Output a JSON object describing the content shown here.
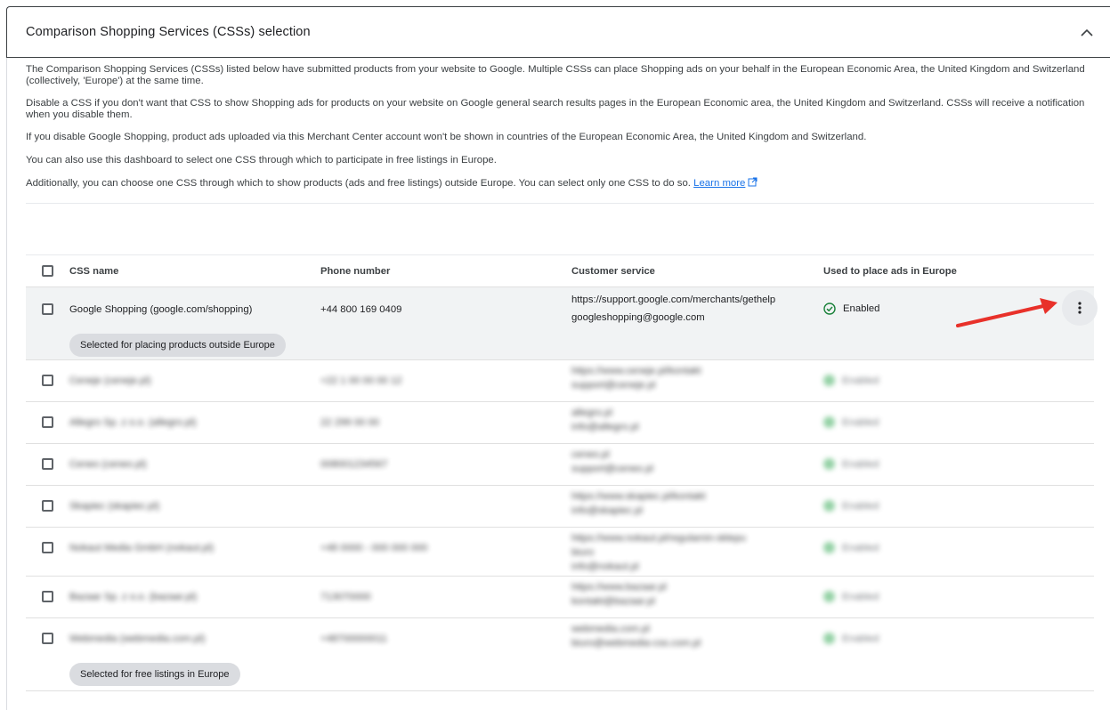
{
  "panel": {
    "title": "Comparison Shopping Services (CSSs) selection",
    "collapse_icon": "chevron-up-icon"
  },
  "intro": {
    "p1": "The Comparison Shopping Services (CSSs) listed below have submitted products from your website to Google. Multiple CSSs can place Shopping ads on your behalf in the European Economic Area, the United Kingdom and Switzerland (collectively, 'Europe') at the same time.",
    "p2": "Disable a CSS if you don't want that CSS to show Shopping ads for products on your website on Google general search results pages in the European Economic area, the United Kingdom and Switzerland. CSSs will receive a notification when you disable them.",
    "p3": "If you disable Google Shopping, product ads uploaded via this Merchant Center account won't be shown in countries of the European Economic Area, the United Kingdom and Switzerland.",
    "p4": "You can also use this dashboard to select one CSS through which to participate in free listings in Europe.",
    "p5": "Additionally, you can choose one CSS through which to show products (ads and free listings) outside Europe. You can select only one CSS to do so.",
    "learn_more": "Learn more",
    "learn_more_icon": "open-in-new-icon"
  },
  "table": {
    "headers": {
      "css_name": "CSS name",
      "phone": "Phone number",
      "customer_service": "Customer service",
      "used_in_europe": "Used to place ads in Europe"
    },
    "first_row": {
      "name": "Google Shopping (google.com/shopping)",
      "phone": "+44 800 169 0409",
      "cs_line1": "https://support.google.com/merchants/gethelp",
      "cs_line2": "googleshopping@google.com",
      "status": "Enabled",
      "status_icon": "check-circle-icon",
      "chip": "Selected for placing products outside Europe",
      "menu_icon": "more-vert-icon"
    },
    "blurred_rows": [
      {
        "name": "Ceneje (ceneje.pl)",
        "phone": "+22 1 00 00 00 12",
        "cs1": "https://www.ceneje.pl/kontakt",
        "cs2": "support@ceneje.pl",
        "status": "Enabled"
      },
      {
        "name": "Allegro Sp. z o.o. (allegro.pl)",
        "phone": "22 299 00 00",
        "cs1": "allegro.pl",
        "cs2": "info@allegro.pl",
        "status": "Enabled"
      },
      {
        "name": "Ceneo (ceneo.pl)",
        "phone": "008001234567",
        "cs1": "ceneo.pl",
        "cs2": "support@ceneo.pl",
        "status": "Enabled"
      },
      {
        "name": "Skapiec (skapiec.pl)",
        "phone": "",
        "cs1": "https://www.skapiec.pl/kontakt",
        "cs2": "info@skapiec.pl",
        "status": "Enabled"
      },
      {
        "name": "Nokaut Media GmbH (nokaut.pl)",
        "phone": "+48 0000 - 000 000 000",
        "cs1": "https://www.nokaut.pl/regulamin-sklepu",
        "cs2": "info@nokaut.pl",
        "cs3": "biuro",
        "status": "Enabled"
      },
      {
        "name": "Bazaar Sp. z o.o. (bazaar.pl)",
        "phone": "713070000",
        "cs1": "https://www.bazaar.pl",
        "cs2": "kontakt@bazaar.pl",
        "status": "Enabled"
      },
      {
        "name": "Webmedia (webmedia.com.pl)",
        "phone": "+48700000011",
        "cs1": "webmedia.com.pl",
        "cs2": "biuro@webmedia-css.com.pl",
        "status": "Enabled"
      }
    ],
    "last_row_chip": "Selected for free listings in Europe"
  },
  "colors": {
    "accent": "#1a73e8",
    "enabled_green": "#188038",
    "arrow_red": "#e8312a",
    "row_highlight": "#f1f3f4",
    "chip_bg": "#dadce0"
  }
}
